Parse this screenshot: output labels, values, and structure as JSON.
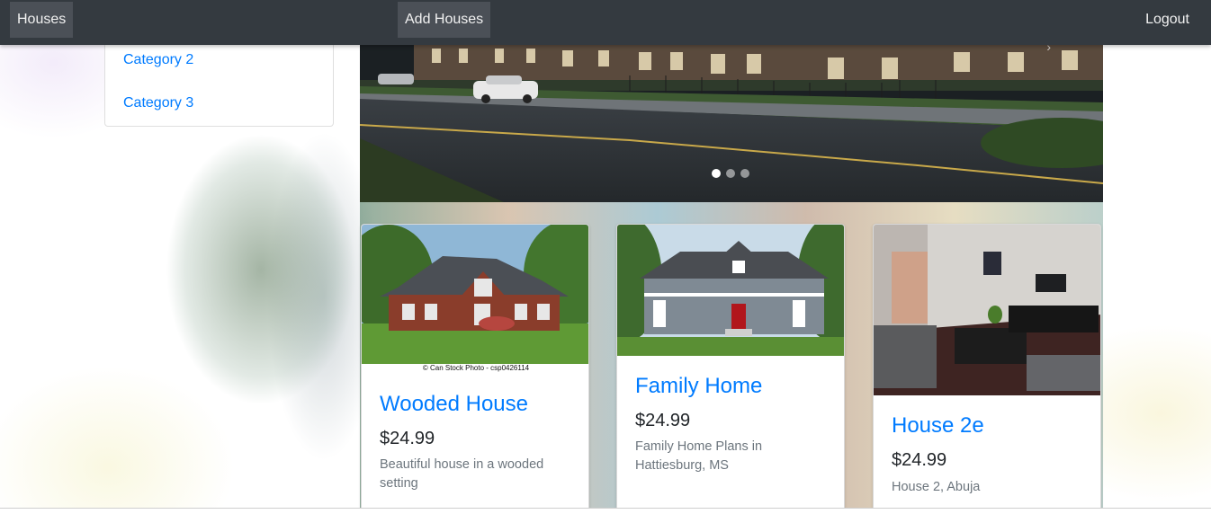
{
  "navbar": {
    "houses_label": "Houses",
    "add_houses_label": "Add Houses",
    "logout_label": "Logout"
  },
  "categories": {
    "items": [
      {
        "label": "Category 2"
      },
      {
        "label": "Category 3"
      }
    ]
  },
  "carousel": {
    "slide_count": 3,
    "active_slide": 1
  },
  "cards": [
    {
      "title": "Wooded House",
      "price": "$24.99",
      "description": "Beautiful house in a wooded setting",
      "image": "brick-house-photo",
      "watermark": "© Can Stock Photo - csp0426114"
    },
    {
      "title": "Family Home",
      "price": "$24.99",
      "description": "Family Home Plans in Hattiesburg, MS",
      "image": "gray-house-photo"
    },
    {
      "title": "House 2e",
      "price": "$24.99",
      "description": "House 2, Abuja",
      "image": "living-room-photo"
    }
  ],
  "colors": {
    "navbar": "#343a40",
    "link": "#007bff",
    "price": "#212529",
    "muted": "#6c757d"
  }
}
